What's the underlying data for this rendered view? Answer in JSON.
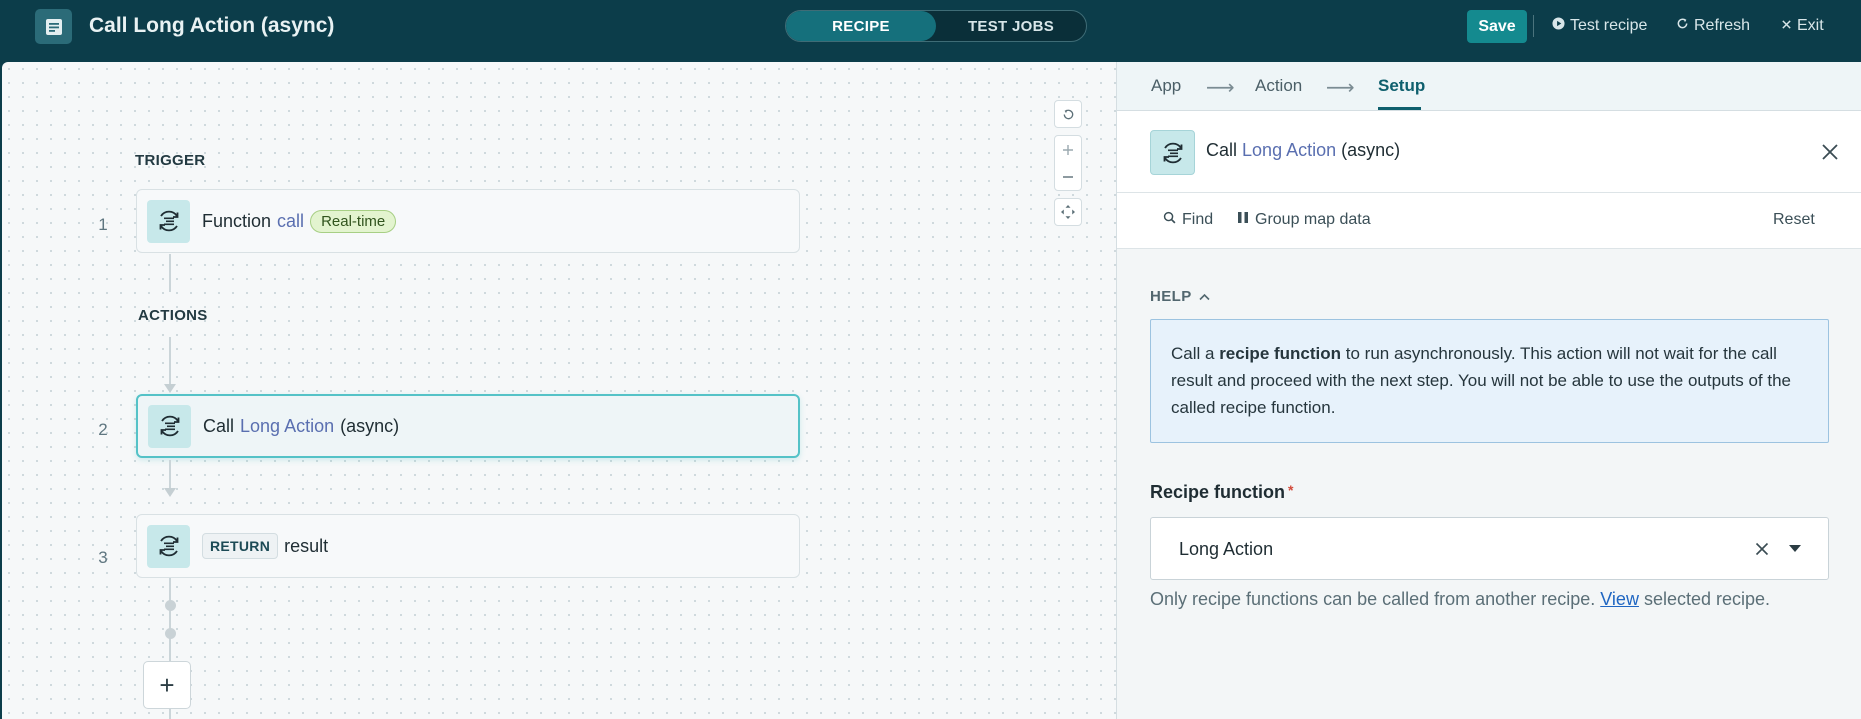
{
  "header": {
    "title": "Call Long Action (async)",
    "tabs": [
      {
        "label": "RECIPE",
        "active": true
      },
      {
        "label": "TEST JOBS",
        "active": false
      }
    ],
    "save_label": "Save",
    "test_recipe_label": "Test recipe",
    "refresh_label": "Refresh",
    "exit_label": "Exit"
  },
  "canvas": {
    "trigger_label": "TRIGGER",
    "actions_label": "ACTIONS",
    "steps": [
      {
        "number": "1",
        "prefix": "Function",
        "accent": "call",
        "badge": "Real-time"
      },
      {
        "number": "2",
        "prefix": "Call",
        "accent": "Long Action",
        "suffix": "(async)"
      },
      {
        "number": "3",
        "badge": "RETURN",
        "suffix": "result"
      }
    ],
    "add_label": "+"
  },
  "panel": {
    "breadcrumbs": [
      {
        "label": "App",
        "active": false
      },
      {
        "label": "Action",
        "active": false
      },
      {
        "label": "Setup",
        "active": true
      }
    ],
    "breadcrumb_arrow": "⟶",
    "title_prefix": "Call",
    "title_accent": "Long Action",
    "title_suffix": "(async)",
    "find_label": "Find",
    "group_map_label": "Group map data",
    "reset_label": "Reset",
    "help_label": "HELP",
    "help_text_pre": "Call a ",
    "help_text_bold": "recipe function",
    "help_text_post": " to run asynchronously. This action will not wait for the call result and proceed with the next step. You will not be able to use the outputs of the called recipe function.",
    "field_label": "Recipe function",
    "required_mark": "*",
    "field_value": "Long Action",
    "hint_pre": "Only recipe functions can be called from another recipe. ",
    "hint_link": "View",
    "hint_post": " selected recipe."
  },
  "colors": {
    "topbar": "#0c3d4a",
    "accent_teal": "#148a8f",
    "selected_border": "#54c2c7",
    "link": "#1f66c2"
  },
  "icons": [
    "document-icon",
    "play-circle-icon",
    "refresh-icon",
    "close-icon",
    "function-call-icon",
    "search-icon",
    "columns-icon",
    "chevron-up-icon",
    "chevron-down-icon",
    "rotate-icon",
    "zoom-in-icon",
    "zoom-out-icon",
    "fit-view-icon",
    "plus-icon"
  ]
}
